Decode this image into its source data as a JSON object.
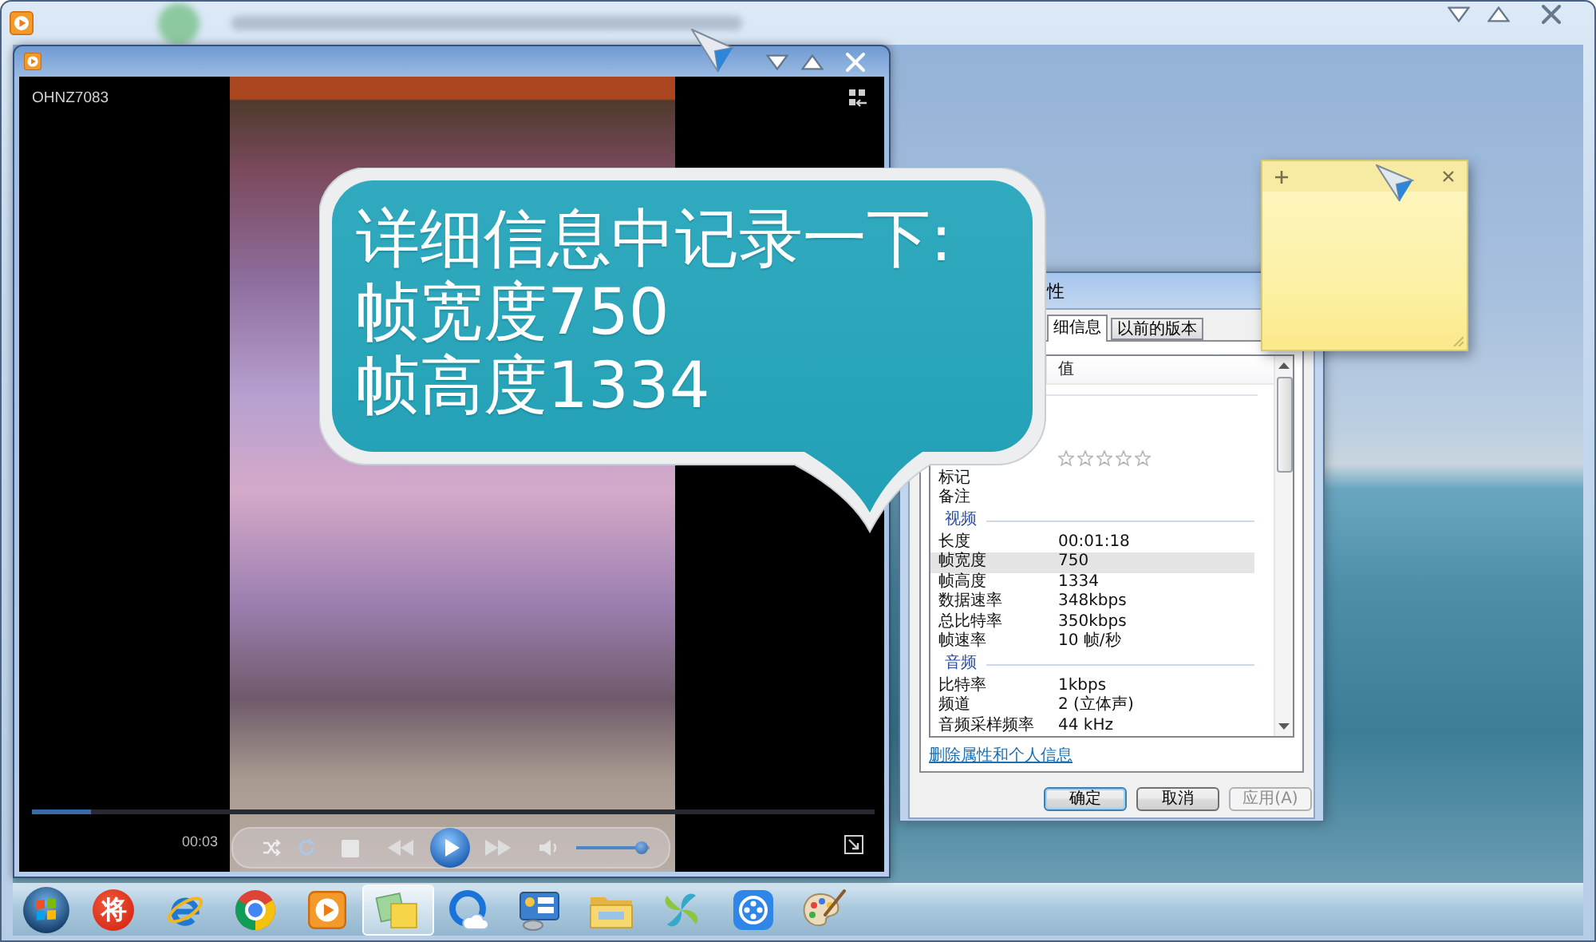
{
  "player": {
    "label": "OHNZ7083",
    "time": "00:03",
    "progress": {
      "level": 0.07
    },
    "volume": {
      "level": 0.9
    }
  },
  "callout": {
    "lines": [
      "详细信息中记录一下:",
      "帧宽度750",
      "帧高度1334"
    ]
  },
  "properties_dialog": {
    "title": "性",
    "tabs": [
      {
        "label": "细信息",
        "selected": true
      },
      {
        "label": "以前的版本",
        "selected": false
      }
    ],
    "value_header": "值",
    "rows": [
      {
        "kind": "rating",
        "stars": 0,
        "selected": false
      },
      {
        "kind": "field",
        "label": "标记",
        "selected": false
      },
      {
        "kind": "field",
        "label": "备注",
        "selected": false
      },
      {
        "kind": "section",
        "label": "视频"
      },
      {
        "kind": "field",
        "label": "长度",
        "value": "00:01:18",
        "selected": false
      },
      {
        "kind": "field",
        "label": "帧宽度",
        "value": "750",
        "selected": true
      },
      {
        "kind": "field",
        "label": "帧高度",
        "value": "1334",
        "selected": false
      },
      {
        "kind": "field",
        "label": "数据速率",
        "value": "348kbps",
        "selected": false
      },
      {
        "kind": "field",
        "label": "总比特率",
        "value": "350kbps",
        "selected": false
      },
      {
        "kind": "field",
        "label": "帧速率",
        "value": "10 帧/秒",
        "selected": false
      },
      {
        "kind": "section",
        "label": "音频"
      },
      {
        "kind": "field",
        "label": "比特率",
        "value": "1kbps",
        "selected": false
      },
      {
        "kind": "field",
        "label": "频道",
        "value": "2 (立体声)",
        "selected": false
      },
      {
        "kind": "field",
        "label": "音频采样频率",
        "value": "44 kHz",
        "selected": false
      }
    ],
    "link": "删除属性和个人信息",
    "buttons": [
      {
        "label": "确定",
        "default": true,
        "disabled": false
      },
      {
        "label": "取消",
        "default": false,
        "disabled": false
      },
      {
        "label": "应用(A)",
        "default": false,
        "disabled": true
      }
    ]
  },
  "taskbar": {
    "items": [
      {
        "kind": "start",
        "selected": false
      },
      {
        "kind": "glyph",
        "glyph": "将",
        "selected": false
      },
      {
        "kind": "e-logo",
        "selected": false
      },
      {
        "kind": "round-logo",
        "selected": false
      },
      {
        "kind": "play-tile",
        "selected": false
      },
      {
        "kind": "notes",
        "selected": true
      },
      {
        "kind": "cloud-ring",
        "selected": false
      },
      {
        "kind": "dashboard",
        "selected": false
      },
      {
        "kind": "folder",
        "selected": false
      },
      {
        "kind": "pinwheel",
        "selected": false
      },
      {
        "kind": "reel",
        "selected": false
      },
      {
        "kind": "palette",
        "selected": false
      }
    ]
  }
}
